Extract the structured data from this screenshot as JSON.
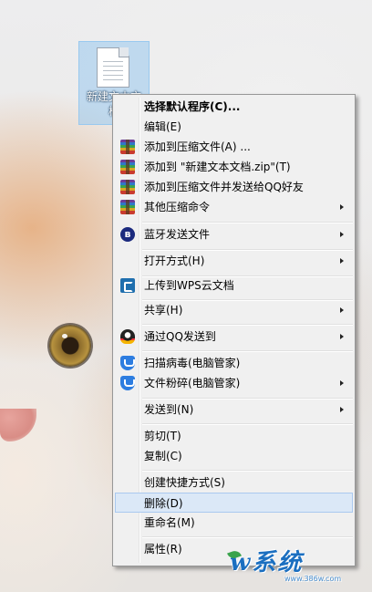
{
  "desktop": {
    "file": {
      "label_line1": "新建文本文",
      "label_line2": "档",
      "icon": "text-file-icon"
    }
  },
  "context_menu": {
    "items": [
      {
        "label": "选择默认程序(C)...",
        "bold": true
      },
      {
        "label": "编辑(E)"
      },
      {
        "label": "添加到压缩文件(A) ...",
        "icon": "winrar-icon"
      },
      {
        "label": "添加到 \"新建文本文档.zip\"(T)",
        "icon": "winrar-icon"
      },
      {
        "label": "添加到压缩文件并发送给QQ好友",
        "icon": "winrar-icon"
      },
      {
        "label": "其他压缩命令",
        "icon": "winrar-icon",
        "submenu": true
      },
      {
        "label": "蓝牙发送文件",
        "icon": "bluetooth-icon",
        "submenu": true
      },
      {
        "label": "打开方式(H)",
        "submenu": true
      },
      {
        "label": "上传到WPS云文档",
        "icon": "wps-cloud-icon"
      },
      {
        "label": "共享(H)",
        "submenu": true
      },
      {
        "label": "通过QQ发送到",
        "icon": "qq-icon",
        "submenu": true
      },
      {
        "label": "扫描病毒(电脑管家)",
        "icon": "shield-icon"
      },
      {
        "label": "文件粉碎(电脑管家)",
        "icon": "shield-icon",
        "submenu": true
      },
      {
        "label": "发送到(N)",
        "submenu": true
      },
      {
        "label": "剪切(T)"
      },
      {
        "label": "复制(C)"
      },
      {
        "label": "创建快捷方式(S)"
      },
      {
        "label": "删除(D)",
        "highlighted": true
      },
      {
        "label": "重命名(M)"
      },
      {
        "label": "属性(R)"
      }
    ]
  },
  "watermark": {
    "text": "w系统",
    "sub": "www.386w.com"
  }
}
